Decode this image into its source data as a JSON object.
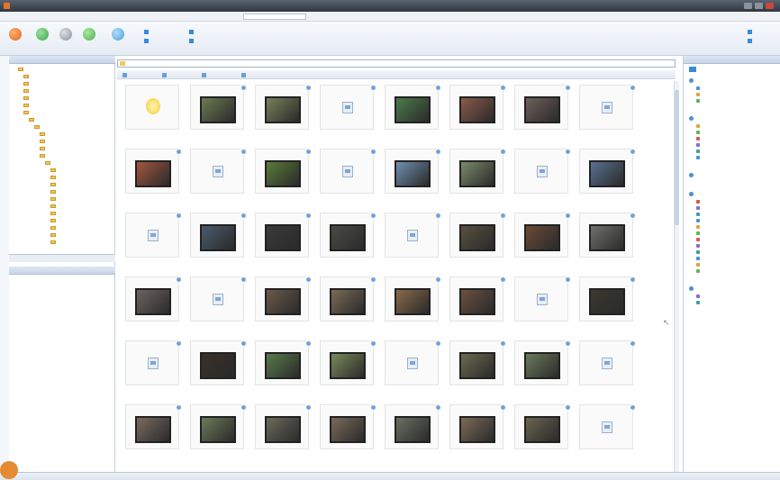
{
  "window": {
    "title": "",
    "accent": "#e2762b"
  },
  "menu": {
    "items": [
      "",
      "",
      "",
      "",
      "",
      "",
      ""
    ]
  },
  "toolbar": {
    "buttons": [
      {
        "label": "",
        "icon": "record-icon",
        "color": "#e0651e"
      },
      {
        "label": "",
        "icon": "globe-icon",
        "color": "#3aa84a"
      },
      {
        "label": "",
        "icon": "disc-icon",
        "color": "#8a9097"
      },
      {
        "label": "",
        "icon": "leaf-icon",
        "color": "#4fb24e"
      },
      {
        "label": "",
        "icon": "refresh-icon",
        "color": "#4a9fdc"
      }
    ],
    "small_actions": [
      "",
      "",
      "",
      ""
    ],
    "right_actions": [
      "",
      ""
    ]
  },
  "left_panel": {
    "header": "",
    "tree_items": [
      "",
      "",
      "",
      "",
      "",
      "",
      "",
      "",
      "",
      "",
      "",
      "",
      "",
      "",
      "",
      "",
      "",
      "",
      "",
      "",
      "",
      "",
      "",
      "",
      ""
    ],
    "tabs": [
      "",
      "",
      ""
    ],
    "lower_header": ""
  },
  "main": {
    "address": "",
    "subbar": [
      "",
      "",
      "",
      ""
    ],
    "thumbnails": [
      {
        "kind": "bulb",
        "caption": ""
      },
      {
        "kind": "photo",
        "color": "#6b7a52",
        "caption": ""
      },
      {
        "kind": "photo",
        "color": "#77805a",
        "caption": ""
      },
      {
        "kind": "doc",
        "caption": ""
      },
      {
        "kind": "photo",
        "color": "#4c7b4a",
        "caption": ""
      },
      {
        "kind": "photo",
        "color": "#8a5a4a",
        "caption": ""
      },
      {
        "kind": "photo",
        "color": "#6e5f5a",
        "caption": ""
      },
      {
        "kind": "doc",
        "caption": ""
      },
      {
        "kind": "photo",
        "color": "#a3563f",
        "caption": ""
      },
      {
        "kind": "doc",
        "caption": ""
      },
      {
        "kind": "photo",
        "color": "#5b7a3a",
        "caption": ""
      },
      {
        "kind": "doc",
        "caption": ""
      },
      {
        "kind": "photo",
        "color": "#6f8fb0",
        "caption": ""
      },
      {
        "kind": "photo",
        "color": "#7a8a6a",
        "caption": ""
      },
      {
        "kind": "doc",
        "caption": ""
      },
      {
        "kind": "photo",
        "color": "#5a7090",
        "caption": ""
      },
      {
        "kind": "doc",
        "caption": ""
      },
      {
        "kind": "photo",
        "color": "#4a5a6a",
        "caption": ""
      },
      {
        "kind": "photo",
        "color": "#3a3a3a",
        "caption": ""
      },
      {
        "kind": "photo",
        "color": "#4a4a44",
        "caption": ""
      },
      {
        "kind": "doc",
        "caption": ""
      },
      {
        "kind": "photo",
        "color": "#5a5040",
        "caption": ""
      },
      {
        "kind": "photo",
        "color": "#6a4a34",
        "caption": ""
      },
      {
        "kind": "photo",
        "color": "#70706a",
        "caption": ""
      },
      {
        "kind": "photo",
        "color": "#6c6460",
        "caption": ""
      },
      {
        "kind": "doc",
        "caption": ""
      },
      {
        "kind": "photo",
        "color": "#6a5a4a",
        "caption": ""
      },
      {
        "kind": "photo",
        "color": "#7a6a58",
        "caption": ""
      },
      {
        "kind": "photo",
        "color": "#8a6a4a",
        "caption": ""
      },
      {
        "kind": "photo",
        "color": "#6a5040",
        "caption": ""
      },
      {
        "kind": "doc",
        "caption": ""
      },
      {
        "kind": "photo",
        "color": "#3a3a30",
        "caption": ""
      },
      {
        "kind": "doc",
        "caption": ""
      },
      {
        "kind": "photo",
        "color": "#3a3028",
        "caption": ""
      },
      {
        "kind": "photo",
        "color": "#5a7a4a",
        "caption": ""
      },
      {
        "kind": "photo",
        "color": "#7a8a5a",
        "caption": ""
      },
      {
        "kind": "doc",
        "caption": ""
      },
      {
        "kind": "photo",
        "color": "#6a6a52",
        "caption": ""
      },
      {
        "kind": "photo",
        "color": "#6a7a5a",
        "caption": ""
      },
      {
        "kind": "doc",
        "caption": ""
      },
      {
        "kind": "photo",
        "color": "#7a6a60",
        "caption": ""
      },
      {
        "kind": "photo",
        "color": "#6a7a5a",
        "caption": ""
      },
      {
        "kind": "photo",
        "color": "#6a6a5a",
        "caption": ""
      },
      {
        "kind": "photo",
        "color": "#7a6a5a",
        "caption": ""
      },
      {
        "kind": "photo",
        "color": "#6a7060",
        "caption": ""
      },
      {
        "kind": "photo",
        "color": "#7a6a58",
        "caption": ""
      },
      {
        "kind": "photo",
        "color": "#6a6450",
        "caption": ""
      },
      {
        "kind": "doc",
        "caption": ""
      }
    ]
  },
  "right_panel": {
    "header": "",
    "tool_label": "",
    "sections": [
      {
        "title": "",
        "items": [
          "",
          "",
          ""
        ]
      },
      {
        "title": "",
        "items": [
          "",
          "",
          "",
          "",
          "",
          ""
        ]
      },
      {
        "title": "",
        "items": []
      },
      {
        "title": "",
        "items": [
          "",
          "",
          "",
          "",
          "",
          "",
          "",
          "",
          "",
          "",
          "",
          ""
        ]
      },
      {
        "title": "",
        "items": [
          "",
          ""
        ]
      }
    ]
  },
  "status": {
    "left": "",
    "middle": "",
    "right": ""
  }
}
